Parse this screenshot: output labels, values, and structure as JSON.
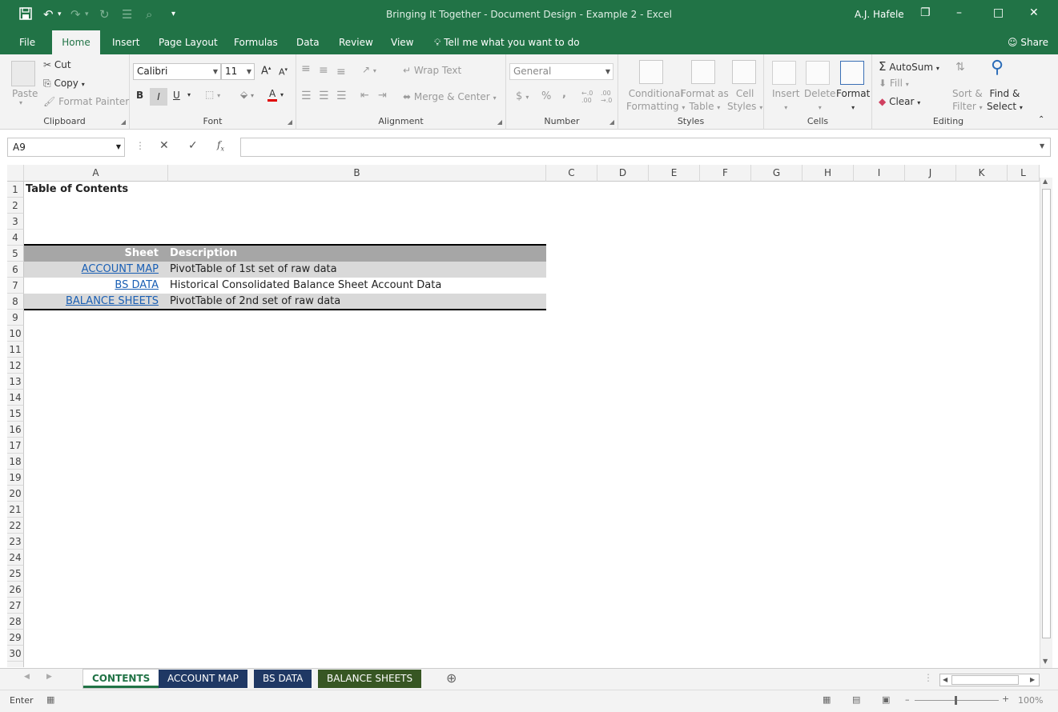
{
  "window": {
    "title": "Bringing It Together - Document Design - Example 2  -  Excel",
    "user": "A.J. Hafele",
    "accent": "#217346"
  },
  "menu": {
    "tabs": [
      "File",
      "Home",
      "Insert",
      "Page Layout",
      "Formulas",
      "Data",
      "Review",
      "View"
    ],
    "active": "Home",
    "tell_me": "Tell me what you want to do",
    "share": "Share"
  },
  "ribbon": {
    "clipboard": {
      "paste": "Paste",
      "cut": "Cut",
      "copy": "Copy",
      "format_painter": "Format Painter",
      "label": "Clipboard"
    },
    "font": {
      "name": "Calibri",
      "size": "11",
      "bold": "B",
      "italic": "I",
      "underline": "U",
      "label": "Font"
    },
    "alignment": {
      "wrap": "Wrap Text",
      "merge": "Merge & Center",
      "label": "Alignment"
    },
    "number": {
      "format": "General",
      "currency": "$",
      "percent": "%",
      "comma": ",",
      "label": "Number"
    },
    "styles": {
      "conditional": "Conditional",
      "conditional2": "Formatting",
      "format_as": "Format as",
      "format_as2": "Table",
      "cell": "Cell",
      "cell2": "Styles",
      "label": "Styles"
    },
    "cells": {
      "insert": "Insert",
      "delete": "Delete",
      "format": "Format",
      "label": "Cells"
    },
    "editing": {
      "autosum": "AutoSum",
      "fill": "Fill",
      "clear": "Clear",
      "sort": "Sort &",
      "sort2": "Filter",
      "find": "Find &",
      "find2": "Select",
      "label": "Editing"
    }
  },
  "formula_bar": {
    "name_box": "A9",
    "formula": ""
  },
  "grid": {
    "columns": [
      "A",
      "B",
      "C",
      "D",
      "E",
      "F",
      "G",
      "H",
      "I",
      "J",
      "K",
      "L"
    ],
    "rows": [
      "1",
      "2",
      "3",
      "4",
      "5",
      "6",
      "7",
      "8",
      "9",
      "10",
      "11",
      "12",
      "13",
      "14",
      "15",
      "16",
      "17",
      "18",
      "19",
      "20",
      "21",
      "22",
      "23",
      "24",
      "25",
      "26",
      "27",
      "28",
      "29",
      "30"
    ],
    "a1": "Table of Contents",
    "toc": {
      "header_sheet": "Sheet",
      "header_description": "Description",
      "entries": [
        {
          "sheet": "ACCOUNT MAP",
          "description": "PivotTable of 1st set of raw data"
        },
        {
          "sheet": "BS DATA",
          "description": "Historical Consolidated Balance Sheet Account Data"
        },
        {
          "sheet": "BALANCE SHEETS",
          "description": "PivotTable of 2nd set of raw data"
        }
      ]
    }
  },
  "sheets": [
    {
      "name": "CONTENTS",
      "color": "#ffffff",
      "active": true
    },
    {
      "name": "ACCOUNT MAP",
      "color": "#1f3864",
      "active": false
    },
    {
      "name": "BS DATA",
      "color": "#1f3864",
      "active": false
    },
    {
      "name": "BALANCE SHEETS",
      "color": "#375623",
      "active": false
    }
  ],
  "status": {
    "mode": "Enter",
    "zoom": "100%"
  }
}
